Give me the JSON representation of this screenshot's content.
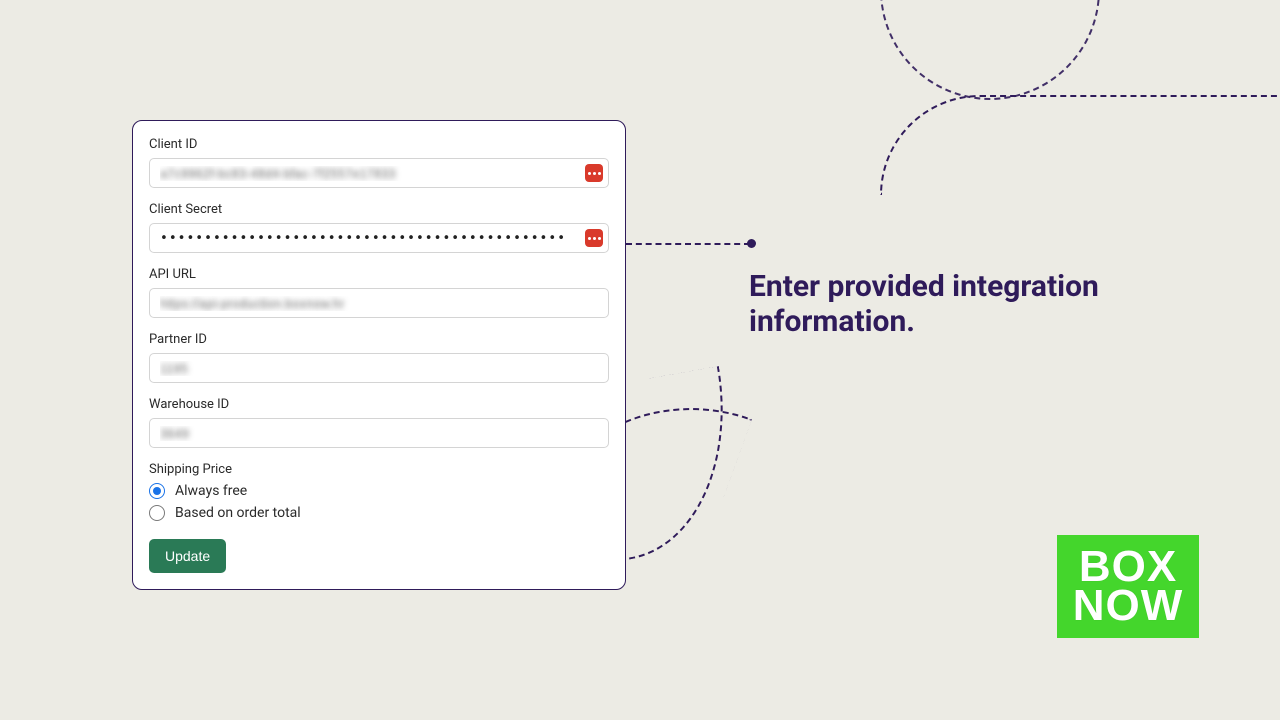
{
  "form": {
    "client_id": {
      "label": "Client ID",
      "value": "a7c9962f-bc83-48d4-bfac-7f2557e17833"
    },
    "client_secret": {
      "label": "Client Secret",
      "value": "••••••••••••••••••••••••••••••••••••••••••••••••••••••••••••"
    },
    "api_url": {
      "label": "API URL",
      "value": "https://api-production.boxnow.hr"
    },
    "partner_id": {
      "label": "Partner ID",
      "value": "1195"
    },
    "warehouse_id": {
      "label": "Warehouse ID",
      "value": "3649"
    },
    "shipping_price": {
      "label": "Shipping Price",
      "options": [
        {
          "label": "Always free",
          "selected": true
        },
        {
          "label": "Based on order total",
          "selected": false
        }
      ]
    },
    "submit_label": "Update"
  },
  "headline": "Enter provided integration information.",
  "logo": {
    "line1": "BOX",
    "line2": "NOW"
  }
}
